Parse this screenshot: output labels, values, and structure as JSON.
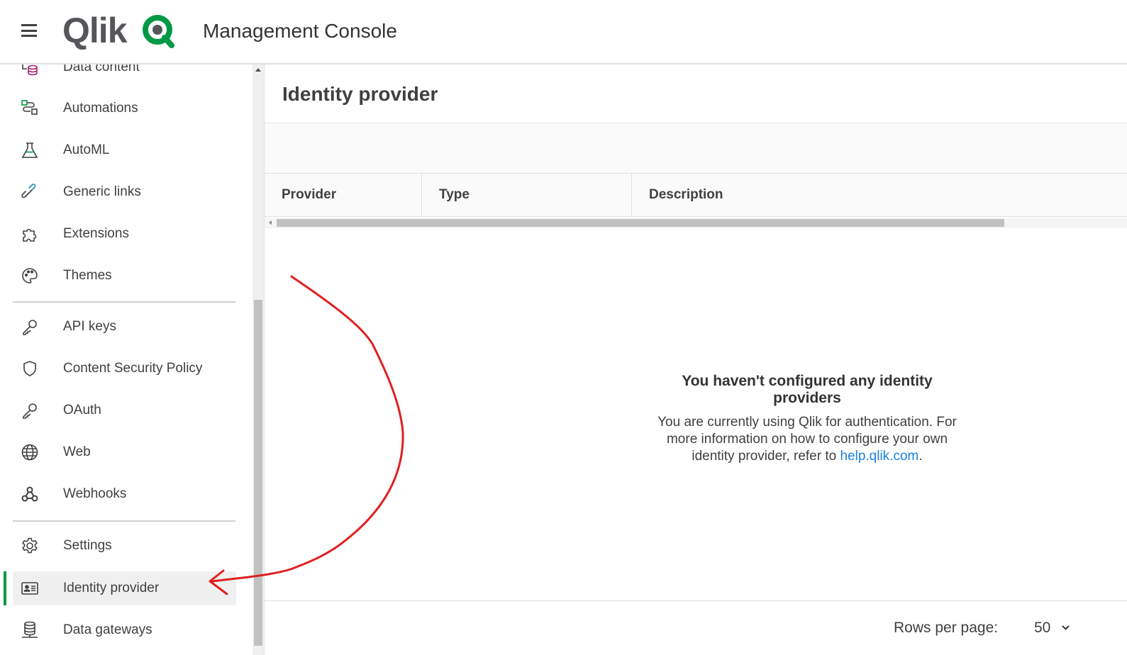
{
  "header": {
    "logo_text": "Qlik",
    "app_title": "Management Console"
  },
  "sidebar": {
    "items": [
      {
        "label": "Data content",
        "icon": "data-content-icon"
      },
      {
        "label": "Automations",
        "icon": "automations-icon"
      },
      {
        "label": "AutoML",
        "icon": "flask-icon"
      },
      {
        "label": "Generic links",
        "icon": "link-icon"
      },
      {
        "label": "Extensions",
        "icon": "puzzle-icon"
      },
      {
        "label": "Themes",
        "icon": "palette-icon"
      },
      {
        "label": "API keys",
        "icon": "key-icon"
      },
      {
        "label": "Content Security Policy",
        "icon": "shield-icon"
      },
      {
        "label": "OAuth",
        "icon": "key-icon"
      },
      {
        "label": "Web",
        "icon": "globe-icon"
      },
      {
        "label": "Webhooks",
        "icon": "webhook-icon"
      },
      {
        "label": "Settings",
        "icon": "gear-icon"
      },
      {
        "label": "Identity provider",
        "icon": "id-card-icon",
        "active": true
      },
      {
        "label": "Data gateways",
        "icon": "database-icon"
      }
    ]
  },
  "main": {
    "title": "Identity provider",
    "columns": [
      "Provider",
      "Type",
      "Description"
    ],
    "empty_title": "You haven't configured any identity providers",
    "empty_text": "You are currently using Qlik for authentication. For more information on how to configure your own identity provider, refer to ",
    "empty_link": "help.qlik.com",
    "empty_suffix": ".",
    "rows_per_page_label": "Rows per page:",
    "rows_per_page_value": "50"
  },
  "colors": {
    "accent": "#009845",
    "link": "#1a82e2",
    "annotation": "#e02020"
  }
}
